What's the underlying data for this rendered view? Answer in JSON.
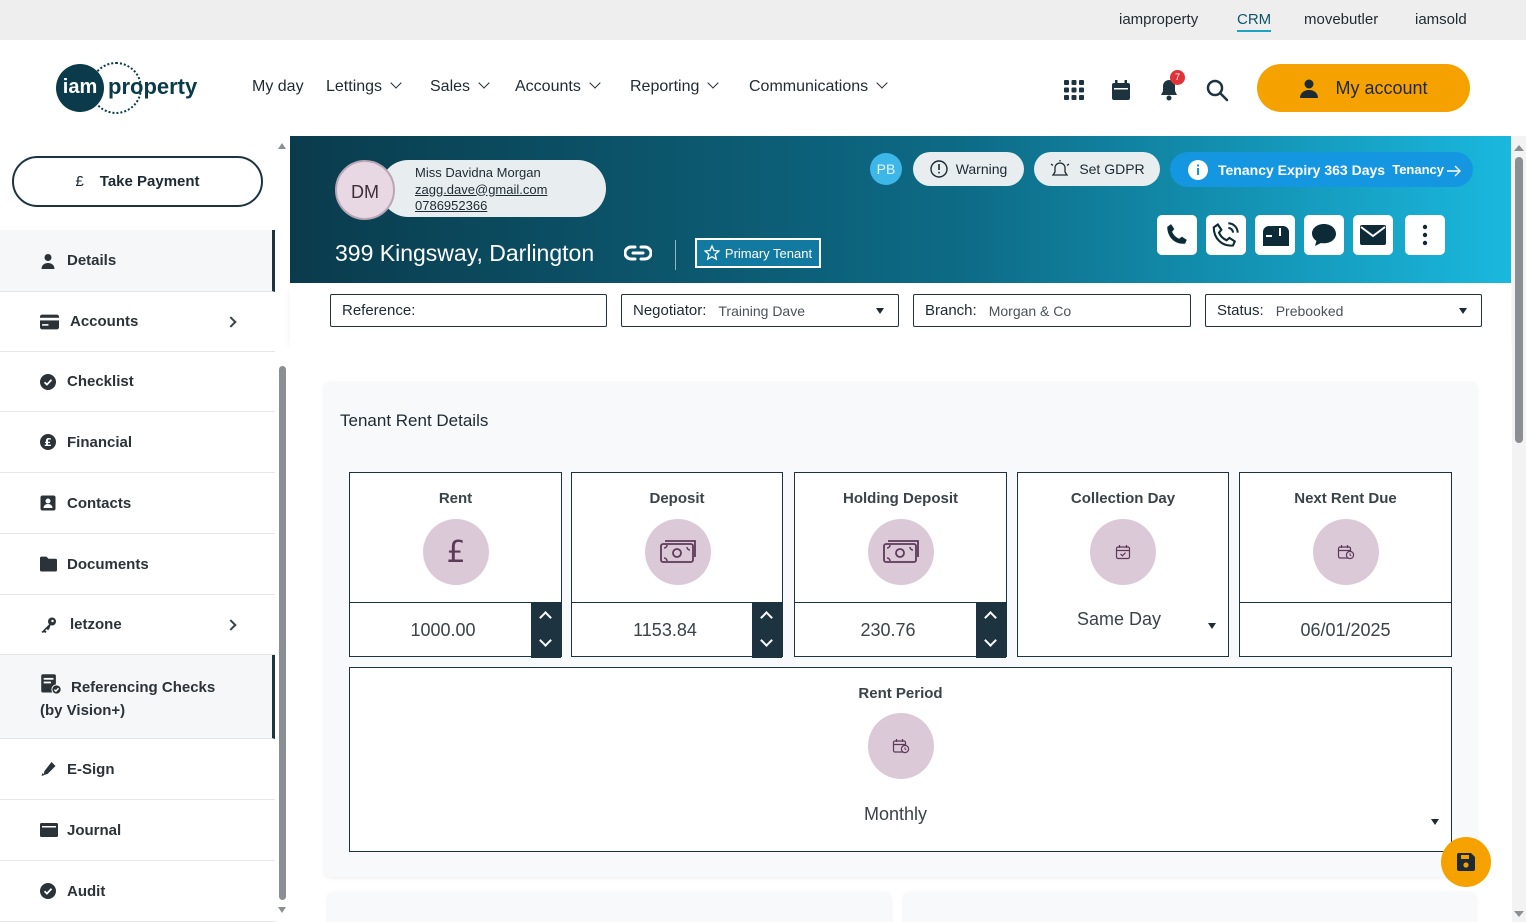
{
  "top_links": [
    "iamproperty",
    "CRM",
    "movebutler",
    "iamsold"
  ],
  "logo": {
    "mark": "iam",
    "text": "property"
  },
  "nav": [
    "My day",
    "Lettings",
    "Sales",
    "Accounts",
    "Reporting",
    "Communications"
  ],
  "notifications_count": "7",
  "my_account_label": "My account",
  "sidebar": {
    "take_payment_label": "Take Payment",
    "take_payment_symbol": "£",
    "items": [
      {
        "label": "Details",
        "icon": "person-icon"
      },
      {
        "label": "Accounts",
        "icon": "card-icon"
      },
      {
        "label": "Checklist",
        "icon": "check-circle-icon"
      },
      {
        "label": "Financial",
        "icon": "pound-circle-icon"
      },
      {
        "label": "Contacts",
        "icon": "contact-card-icon"
      },
      {
        "label": "Documents",
        "icon": "folder-icon"
      },
      {
        "label": "letzone",
        "icon": "key-icon"
      },
      {
        "label": "Referencing Checks",
        "label2": "(by Vision+)",
        "icon": "referencing-icon"
      },
      {
        "label": "E-Sign",
        "icon": "pen-icon"
      },
      {
        "label": "Journal",
        "icon": "journal-icon"
      },
      {
        "label": "Audit",
        "icon": "check-circle-icon"
      }
    ]
  },
  "tenant": {
    "initials": "DM",
    "name": "Miss Davidna Morgan",
    "email": "zagg.dave@gmail.com",
    "phone": "0786952366",
    "address": "399 Kingsway, Darlington",
    "primary_label": "Primary Tenant",
    "pb": "PB",
    "warning_label": "Warning",
    "gdpr_label": "Set GDPR",
    "tenancy_expiry": "Tenancy Expiry 363 Days",
    "tenancy_link": "Tenancy"
  },
  "filters": {
    "reference_label": "Reference:",
    "reference_value": "",
    "negotiator_label": "Negotiator:",
    "negotiator_value": "Training Dave",
    "branch_label": "Branch:",
    "branch_value": "Morgan & Co",
    "status_label": "Status:",
    "status_value": "Prebooked"
  },
  "rent_details": {
    "title": "Tenant Rent Details",
    "rent_label": "Rent",
    "rent_value": "1000.00",
    "deposit_label": "Deposit",
    "deposit_value": "1153.84",
    "holding_label": "Holding Deposit",
    "holding_value": "230.76",
    "collection_label": "Collection Day",
    "collection_value": "Same Day",
    "next_due_label": "Next Rent Due",
    "next_due_value": "06/01/2025",
    "period_label": "Rent Period",
    "period_value": "Monthly"
  },
  "colors": {
    "accent": "#f5a200",
    "dark": "#1d3440",
    "banner_start": "#0a3b4c",
    "banner_end": "#1ab8de",
    "icon_circle": "#dcc9d8"
  }
}
